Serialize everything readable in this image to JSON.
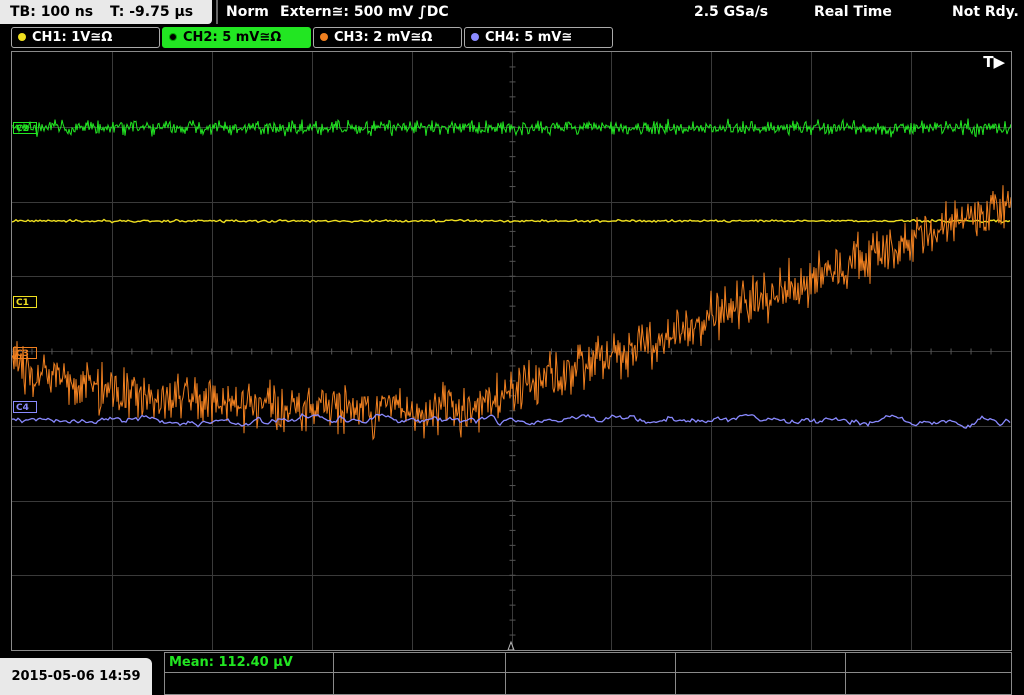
{
  "topbar": {
    "timebase": "TB: 100 ns",
    "trigger_pos": "T: -9.75 µs",
    "mode": "Norm",
    "trigger_source": "Extern≅: 500 mV ∫DC",
    "sample_rate": "2.5 GSa/s",
    "acq_mode": "Real Time",
    "status": "Not Rdy."
  },
  "channels": [
    {
      "label": "CH1: 1V≅Ω",
      "color": "#f0e020",
      "active": false
    },
    {
      "label": "CH2: 5 mV≅Ω",
      "color": "#22e622",
      "active": true
    },
    {
      "label": "CH3: 2 mV≅Ω",
      "color": "#f08020",
      "active": false
    },
    {
      "label": "CH4: 5 mV≅",
      "color": "#8a8aff",
      "active": false
    }
  ],
  "plot": {
    "trigger_marker": "T▶",
    "offset_markers": [
      {
        "label": "C1",
        "color": "#f0e020"
      },
      {
        "label": "C2",
        "color": "#22e622"
      },
      {
        "label": "C3",
        "color": "#f08020"
      },
      {
        "label": "C4",
        "color": "#8a8aff"
      }
    ]
  },
  "bottom": {
    "datetime": "2015-05-06 14:59",
    "measurement": "Mean: 112.40 µV"
  }
}
